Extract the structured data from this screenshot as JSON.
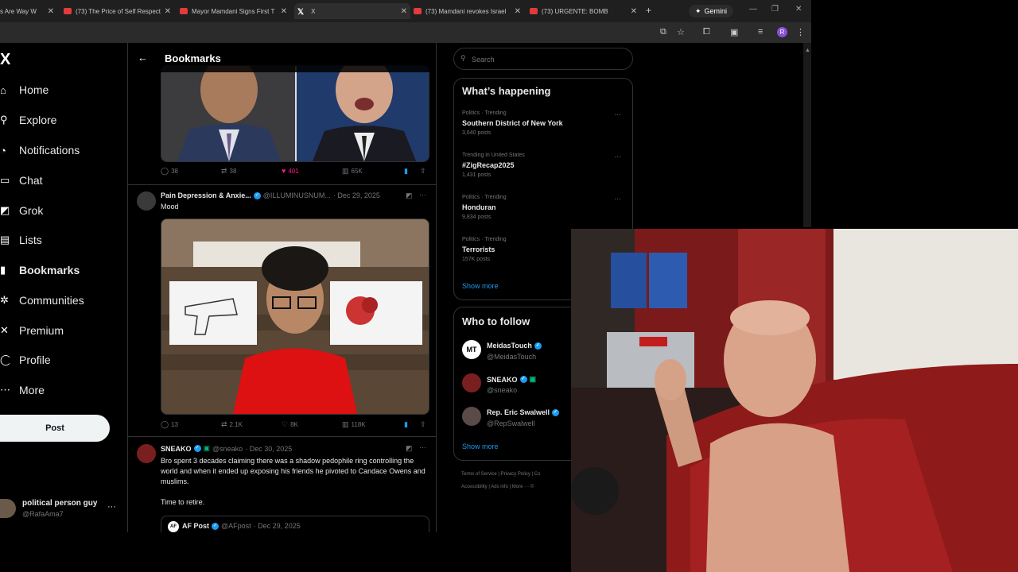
{
  "browser": {
    "tabs": [
      {
        "title": "s Are Way W",
        "icon": "youtube-icon"
      },
      {
        "title": "(73) The Price of Self Respect",
        "icon": "youtube-icon"
      },
      {
        "title": "Mayor Mamdani Signs First T",
        "icon": "youtube-icon"
      },
      {
        "title": "X",
        "icon": "x-icon"
      },
      {
        "title": "(73) Mamdani revokes Israel",
        "icon": "youtube-icon"
      },
      {
        "title": "(73) URGENTE: BOMB",
        "icon": "youtube-icon"
      }
    ],
    "new_tab": "+",
    "gemini_label": "Gemini",
    "profile_letter": "R"
  },
  "sidebar": {
    "logo": "X",
    "items": [
      {
        "label": "Home",
        "icon": "home-icon",
        "glyph": "⌂"
      },
      {
        "label": "Explore",
        "icon": "search-icon",
        "glyph": "⚲"
      },
      {
        "label": "Notifications",
        "icon": "bell-icon",
        "glyph": "◔"
      },
      {
        "label": "Chat",
        "icon": "chat-icon",
        "glyph": "▭"
      },
      {
        "label": "Grok",
        "icon": "grok-icon",
        "glyph": "◩"
      },
      {
        "label": "Lists",
        "icon": "list-icon",
        "glyph": "▤"
      },
      {
        "label": "Bookmarks",
        "icon": "bookmark-icon",
        "glyph": "▮"
      },
      {
        "label": "Communities",
        "icon": "communities-icon",
        "glyph": "✲"
      },
      {
        "label": "Premium",
        "icon": "premium-x-icon",
        "glyph": "✕"
      },
      {
        "label": "Profile",
        "icon": "profile-icon",
        "glyph": "◯"
      },
      {
        "label": "More",
        "icon": "more-circle-icon",
        "glyph": "⋯"
      }
    ],
    "post_button": "Post",
    "user": {
      "name": "political person guy",
      "handle": "@RafaAma7"
    }
  },
  "main": {
    "back_icon": "←",
    "title": "Bookmarks",
    "tweet1_actions": {
      "replies": "38",
      "reposts": "38",
      "likes": "401",
      "views": "65K"
    },
    "tweet2": {
      "name": "Pain Depression & Anxie...",
      "handle": "@ILLUMINUSNUM...",
      "date": "· Dec 29, 2025",
      "text": "Mood",
      "actions": {
        "replies": "13",
        "reposts": "2.1K",
        "likes": "8K",
        "views": "118K"
      }
    },
    "tweet3": {
      "name": "SNEAKO",
      "handle": "@sneako",
      "date": "· Dec 30, 2025",
      "text": "Bro spent 3 decades claiming there was a shadow pedophile ring controlling the world and when it ended up exposing his friends he pivoted to Candace Owens and muslims.",
      "text2": "Time to retire.",
      "quote": {
        "name": "AF Post",
        "handle": "@AFpost",
        "date": "· Dec 29, 2025"
      }
    }
  },
  "right": {
    "search_placeholder": "Search",
    "trending_title": "What’s happening",
    "trends": [
      {
        "context": "Politics · Trending",
        "topic": "Southern District of New York",
        "count": "3,640 posts"
      },
      {
        "context": "Trending in United States",
        "topic": "#ZigRecap2025",
        "count": "1,431 posts"
      },
      {
        "context": "Politics · Trending",
        "topic": "Honduran",
        "count": "9,834 posts"
      },
      {
        "context": "Politics · Trending",
        "topic": "Terrorists",
        "count": "157K posts"
      }
    ],
    "show_more": "Show more",
    "follow_title": "Who to follow",
    "follow": [
      {
        "name": "MeidasTouch",
        "handle": "@MeidasTouch",
        "avatar_text": "MT"
      },
      {
        "name": "SNEAKO",
        "handle": "@sneako",
        "avatar_text": ""
      },
      {
        "name": "Rep. Eric Swalwell",
        "handle": "@RepSwalwell",
        "avatar_text": ""
      }
    ],
    "follow_show_more": "Show more",
    "footer1": "Terms of Service  |  Privacy Policy  |  Co",
    "footer2": "Accessibility  |  Ads info  |  More ···  ©"
  },
  "colors": {
    "accent": "#1d9bf0",
    "like": "#f91880",
    "background": "#000000"
  }
}
